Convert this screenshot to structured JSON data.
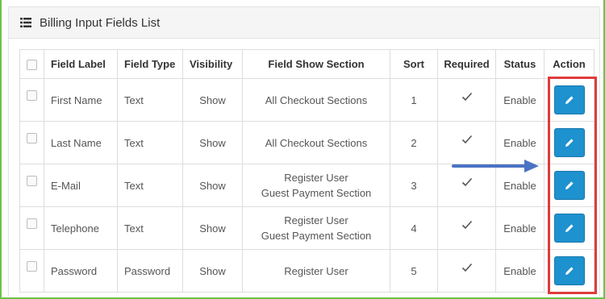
{
  "panel": {
    "title": "Billing Input Fields List",
    "title_icon": "list-icon"
  },
  "table": {
    "columns": [
      "Field Label",
      "Field Type",
      "Visibility",
      "Field Show Section",
      "Sort",
      "Required",
      "Status",
      "Action"
    ],
    "rows": [
      {
        "label": "First Name",
        "type": "Text",
        "visibility": "Show",
        "section": [
          "All Checkout Sections"
        ],
        "sort": "1",
        "required": true,
        "status": "Enable"
      },
      {
        "label": "Last Name",
        "type": "Text",
        "visibility": "Show",
        "section": [
          "All Checkout Sections"
        ],
        "sort": "2",
        "required": true,
        "status": "Enable"
      },
      {
        "label": "E-Mail",
        "type": "Text",
        "visibility": "Show",
        "section": [
          "Register User",
          "Guest Payment Section"
        ],
        "sort": "3",
        "required": true,
        "status": "Enable"
      },
      {
        "label": "Telephone",
        "type": "Text",
        "visibility": "Show",
        "section": [
          "Register User",
          "Guest Payment Section"
        ],
        "sort": "4",
        "required": true,
        "status": "Enable"
      },
      {
        "label": "Password",
        "type": "Password",
        "visibility": "Show",
        "section": [
          "Register User"
        ],
        "sort": "5",
        "required": true,
        "status": "Enable"
      }
    ]
  },
  "colors": {
    "edit_button": "#1e91cf",
    "highlight_box": "#e03b3b",
    "arrow": "#4a73c4",
    "frame_border": "#6cc24a"
  },
  "icons": {
    "edit": "pencil-icon",
    "required": "checkmark-icon"
  }
}
